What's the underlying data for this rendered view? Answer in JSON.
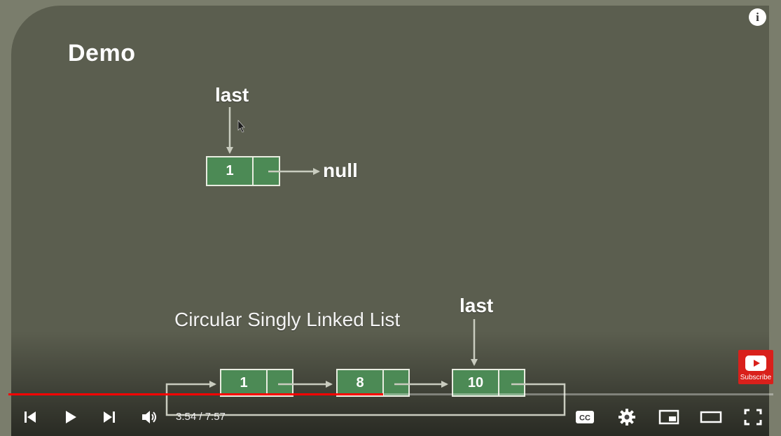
{
  "slide": {
    "title": "Demo",
    "top_diagram": {
      "pointer_label": "last",
      "node_value": "1",
      "null_label": "null"
    },
    "bottom_diagram": {
      "caption": "Circular Singly Linked List",
      "pointer_label": "last",
      "nodes": [
        "1",
        "8",
        "10"
      ]
    }
  },
  "overlay": {
    "info_icon": "info-icon",
    "subscribe_label": "Subscribe"
  },
  "player": {
    "current_time": "3:54",
    "duration": "7:57",
    "time_display": "3:54 / 7:57",
    "progress_fraction": 0.49,
    "accent_color": "#ff0000",
    "controls_left": [
      "previous-icon",
      "play-icon",
      "next-icon",
      "volume-icon"
    ],
    "controls_right": [
      "cc-icon",
      "settings-icon",
      "miniplayer-icon",
      "theater-icon",
      "fullscreen-icon"
    ]
  }
}
